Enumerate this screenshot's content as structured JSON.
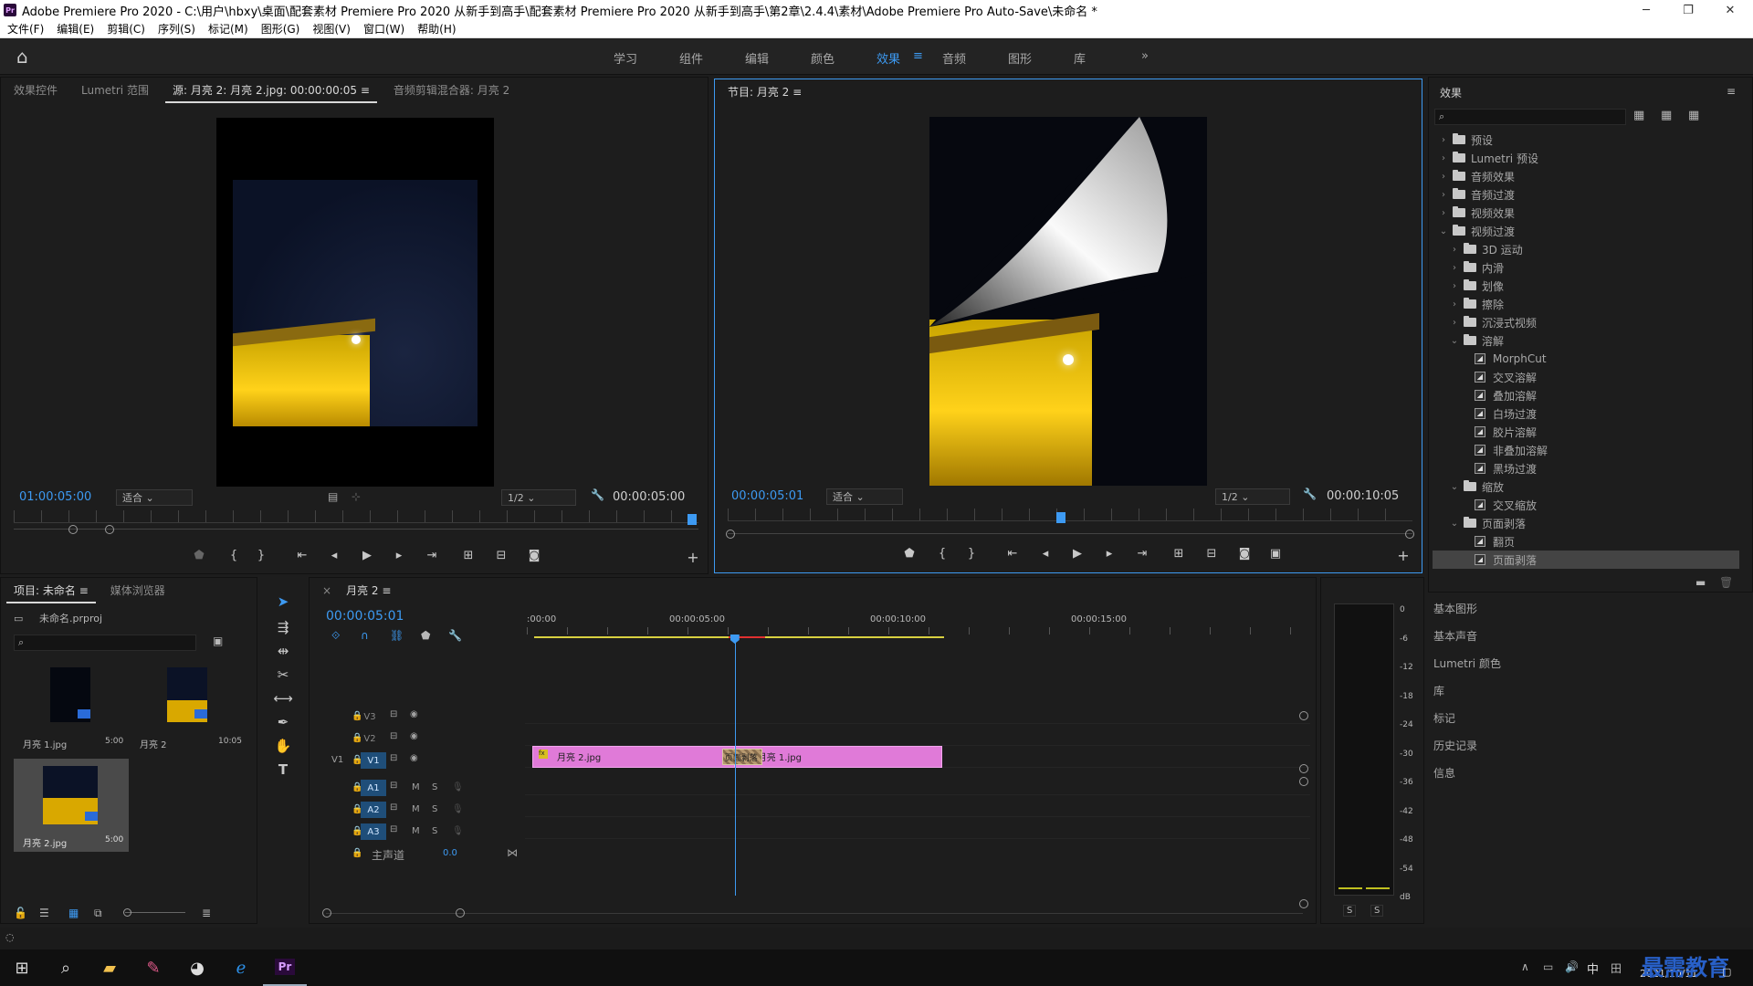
{
  "window": {
    "title": "Adobe Premiere Pro 2020 - C:\\用户\\hbxy\\桌面\\配套素材 Premiere Pro 2020 从新手到高手\\配套素材 Premiere Pro 2020 从新手到高手\\第2章\\2.4.4\\素材\\Adobe Premiere Pro Auto-Save\\未命名 *",
    "app_icon": "Pr"
  },
  "menu": [
    "文件(F)",
    "编辑(E)",
    "剪辑(C)",
    "序列(S)",
    "标记(M)",
    "图形(G)",
    "视图(V)",
    "窗口(W)",
    "帮助(H)"
  ],
  "workspaces": [
    "学习",
    "组件",
    "编辑",
    "颜色",
    "效果",
    "音频",
    "图形",
    "库"
  ],
  "active_workspace": "效果",
  "source_monitor": {
    "tabs": [
      "效果控件",
      "Lumetri 范围",
      "源: 月亮 2: 月亮 2.jpg: 00:00:00:05",
      "音频剪辑混合器: 月亮 2"
    ],
    "timecode_in": "01:00:05:00",
    "fit": "适合",
    "resolution": "1/2",
    "timecode_out": "00:00:05:00"
  },
  "program_monitor": {
    "tab": "节目: 月亮 2",
    "timecode_in": "00:00:05:01",
    "fit": "适合",
    "resolution": "1/2",
    "timecode_out": "00:00:10:05"
  },
  "effects_panel": {
    "title": "效果",
    "tree": [
      {
        "label": "预设",
        "type": "folder",
        "level": 0,
        "open": false
      },
      {
        "label": "Lumetri 预设",
        "type": "folder",
        "level": 0,
        "open": false
      },
      {
        "label": "音频效果",
        "type": "folder",
        "level": 0,
        "open": false
      },
      {
        "label": "音频过渡",
        "type": "folder",
        "level": 0,
        "open": false
      },
      {
        "label": "视频效果",
        "type": "folder",
        "level": 0,
        "open": false
      },
      {
        "label": "视频过渡",
        "type": "folder",
        "level": 0,
        "open": true
      },
      {
        "label": "3D 运动",
        "type": "folder",
        "level": 1,
        "open": false
      },
      {
        "label": "内滑",
        "type": "folder",
        "level": 1,
        "open": false
      },
      {
        "label": "划像",
        "type": "folder",
        "level": 1,
        "open": false
      },
      {
        "label": "擦除",
        "type": "folder",
        "level": 1,
        "open": false
      },
      {
        "label": "沉浸式视频",
        "type": "folder",
        "level": 1,
        "open": false
      },
      {
        "label": "溶解",
        "type": "folder",
        "level": 1,
        "open": true
      },
      {
        "label": "MorphCut",
        "type": "fx",
        "level": 2
      },
      {
        "label": "交叉溶解",
        "type": "fx",
        "level": 2
      },
      {
        "label": "叠加溶解",
        "type": "fx",
        "level": 2
      },
      {
        "label": "白场过渡",
        "type": "fx",
        "level": 2
      },
      {
        "label": "胶片溶解",
        "type": "fx",
        "level": 2
      },
      {
        "label": "非叠加溶解",
        "type": "fx",
        "level": 2
      },
      {
        "label": "黑场过渡",
        "type": "fx",
        "level": 2
      },
      {
        "label": "缩放",
        "type": "folder",
        "level": 1,
        "open": true
      },
      {
        "label": "交叉缩放",
        "type": "fx",
        "level": 2
      },
      {
        "label": "页面剥落",
        "type": "folder",
        "level": 1,
        "open": true
      },
      {
        "label": "翻页",
        "type": "fx",
        "level": 2
      },
      {
        "label": "页面剥落",
        "type": "fx",
        "level": 2,
        "selected": true
      }
    ],
    "side_panels": [
      "基本图形",
      "基本声音",
      "Lumetri 颜色",
      "库",
      "标记",
      "历史记录",
      "信息"
    ]
  },
  "project_panel": {
    "tabs": [
      "项目: 未命名",
      "媒体浏览器"
    ],
    "project_file": "未命名.prproj",
    "items": [
      {
        "name": "月亮 1.jpg",
        "duration": "5:00"
      },
      {
        "name": "月亮 2",
        "duration": "10:05"
      },
      {
        "name": "月亮 2.jpg",
        "duration": "5:00"
      }
    ]
  },
  "timeline": {
    "tab": "月亮 2",
    "timecode": "00:00:05:01",
    "ruler": [
      ":00:00",
      "00:00:05:00",
      "00:00:10:00",
      "00:00:15:00"
    ],
    "video_tracks": [
      "V3",
      "V2",
      "V1"
    ],
    "audio_tracks": [
      "A1",
      "A2",
      "A3"
    ],
    "source_patch_v": "V1",
    "master_label": "主声道",
    "master_value": "0.0",
    "track_toggle_m": "M",
    "track_toggle_s": "S",
    "clips": [
      {
        "name": "月亮 2.jpg",
        "start_sec": 0,
        "end_sec": 5.04
      },
      {
        "name": "月亮 1.jpg",
        "start_sec": 5.04,
        "end_sec": 10.2
      }
    ],
    "transition_label": "页面剥落",
    "playhead_sec": 5.04
  },
  "audio_meter": {
    "scale": [
      "0",
      "-6",
      "-12",
      "-18",
      "-24",
      "-30",
      "-36",
      "-42",
      "-48",
      "-54",
      "dB"
    ],
    "solo_labels": [
      "S",
      "S"
    ]
  },
  "taskbar": {
    "ime": "中",
    "date": "2021/10/11",
    "watermark": "最需教育"
  },
  "colors": {
    "accent": "#3d9af2",
    "clip": "#e07ad8",
    "playhead": "#3d9af2"
  }
}
